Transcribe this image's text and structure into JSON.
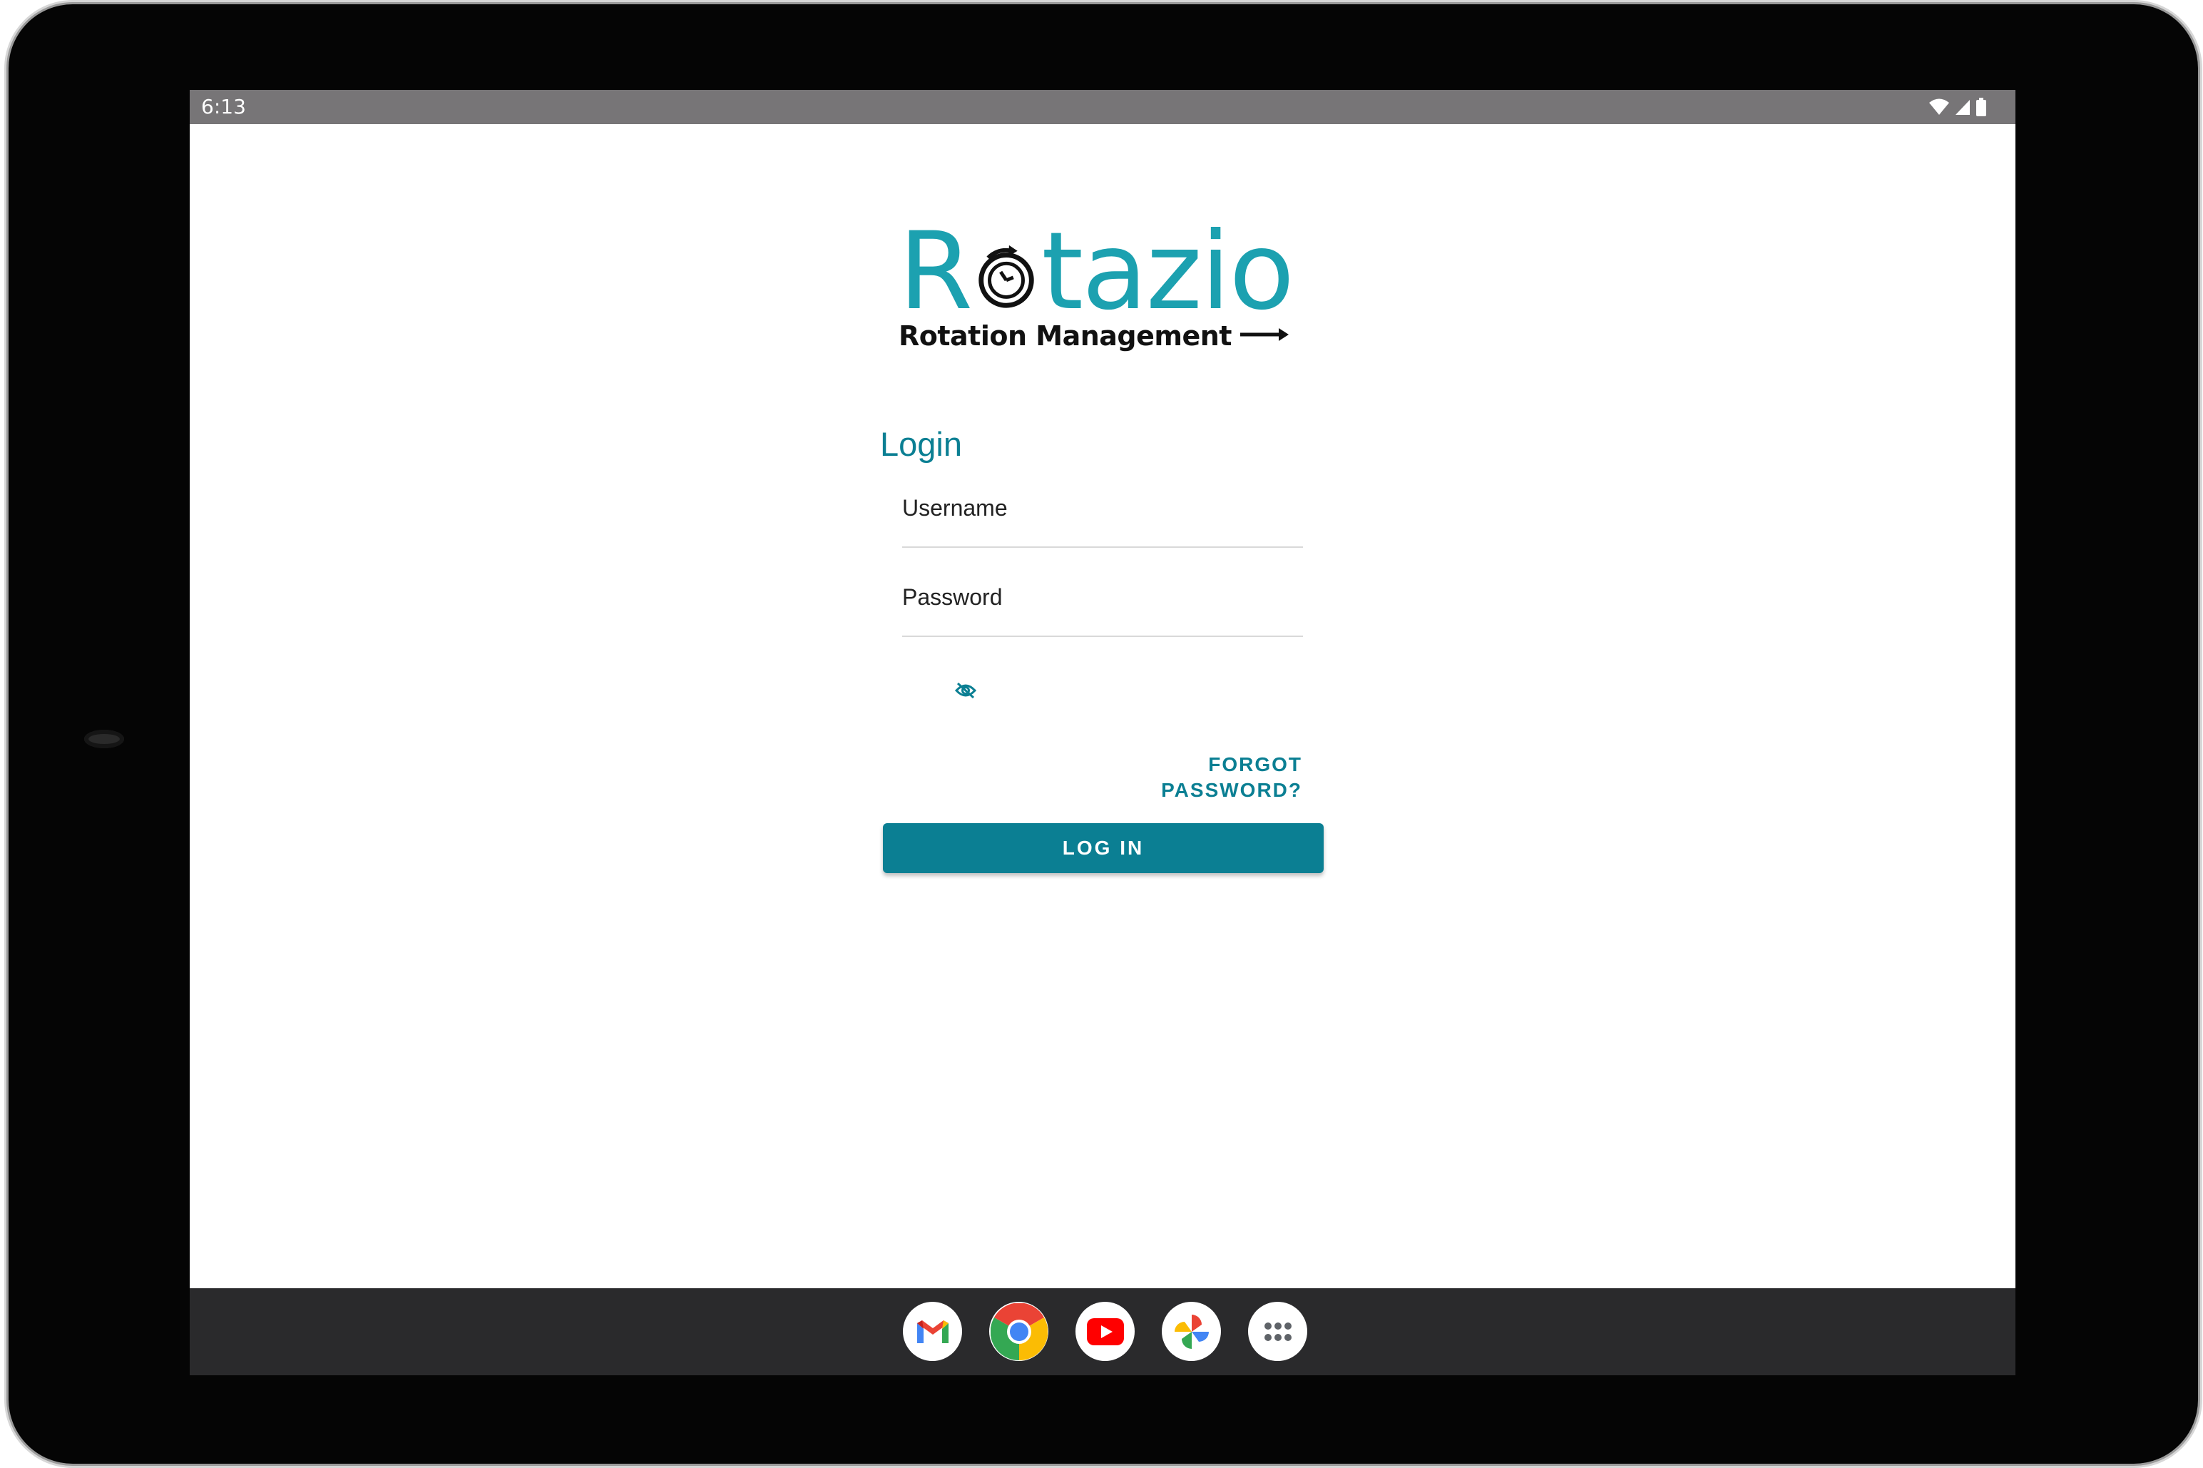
{
  "status_bar": {
    "time": "6:13",
    "icons": [
      "wifi-icon",
      "signal-icon",
      "battery-icon"
    ]
  },
  "logo": {
    "wordmark_prefix": "R",
    "wordmark_suffix": "tazio",
    "tagline": "Rotation Management",
    "brand_color": "#1ca1b0"
  },
  "login": {
    "title": "Login",
    "username_placeholder": "Username",
    "password_placeholder": "Password",
    "toggle_icon": "eye-off-icon",
    "forgot_password_label": "FORGOT PASSWORD?",
    "submit_label": "LOG IN",
    "accent_color": "#0b7f93"
  },
  "dock": {
    "apps": [
      {
        "name": "Gmail",
        "icon": "gmail-icon"
      },
      {
        "name": "Chrome",
        "icon": "chrome-icon"
      },
      {
        "name": "YouTube",
        "icon": "youtube-icon"
      },
      {
        "name": "Photos",
        "icon": "photos-icon"
      },
      {
        "name": "App drawer",
        "icon": "apps-grid-icon"
      }
    ]
  }
}
